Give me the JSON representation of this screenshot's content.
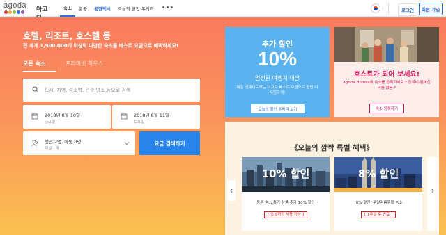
{
  "header": {
    "logo_word": "agoda",
    "logo_ko": "아고다",
    "logo_colors": [
      "#e23a3a",
      "#f9a23f",
      "#8dc63f",
      "#2b6fd9",
      "#9b59b6"
    ],
    "nav": [
      {
        "label": "숙소",
        "active": true
      },
      {
        "label": "항공",
        "active": false
      },
      {
        "label": "공항택시",
        "active": false,
        "highlight": true
      },
      {
        "label": "오늘의 할인 우리미",
        "active": false
      }
    ],
    "more_label": "•••",
    "login_label": "로그인",
    "signup_label": "회원 가입"
  },
  "hero": {
    "title": "호텔, 리조트, 호스텔 등",
    "subtitle": "전 세계 1,900,000개 이상의 다양한 숙소를 베스트 요금으로 예약하세요!",
    "tabs": [
      "모든 숙소",
      "프라이빗 하우스"
    ],
    "search_placeholder": "도시, 지역, 숙소명, 관광 명소 등으로 검색",
    "checkin_date": "2018년 8월 10일",
    "checkin_day": "금요일",
    "checkout_date": "2018년 8월 11일",
    "checkout_day": "토요일",
    "guests": "성인 2명, 아동 0명",
    "rooms": "객실 1개",
    "search_button": "요금 검색하기"
  },
  "promo": {
    "line1": "추가 할인",
    "line2": "10%",
    "line3": "엄선된 여행지 대상",
    "line4": "매일 업데이트되는 아고다 베스트 요금으로 할인 더 저렴하게!",
    "button": "오늘의 할인 우리미 보기"
  },
  "host": {
    "title": "호스트가 되어 보세요!",
    "sub": "Agoda Homes에 숙소를 등록하세요 * 등록비·멤버십 비용 없음 *",
    "button": "숙소 등록하기"
  },
  "deals": {
    "title": "《오늘의 깜짝 특별 혜택》",
    "arrow_left": "‹",
    "arrow_right": "›",
    "items": [
      {
        "pct": "10% 할인",
        "desc": "동론 숙소 특가 상품 추가 10% 할인",
        "tag": "[ 오늘까지 사용 가능 ]"
      },
      {
        "pct": "8% 할인",
        "desc": "[8% 할인] 쿠알라룸푸르 숙소",
        "tag": "[ 1주일 후 만료 ]"
      }
    ]
  }
}
